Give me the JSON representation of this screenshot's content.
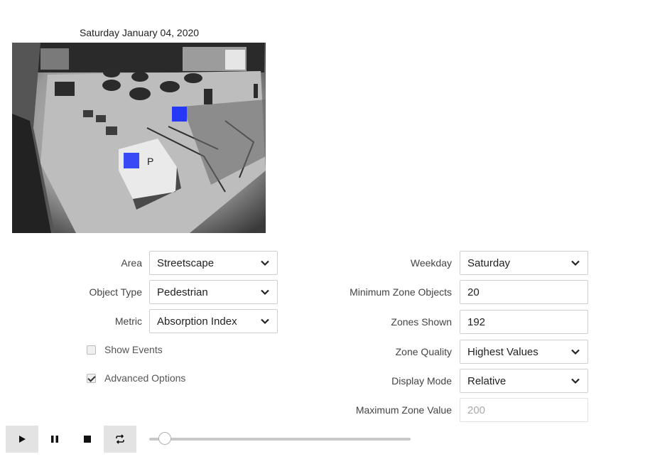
{
  "camera": {
    "date": "Saturday January 04, 2020",
    "sign_letter": "P"
  },
  "left_form": {
    "area": {
      "label": "Area",
      "value": "Streetscape"
    },
    "object_type": {
      "label": "Object Type",
      "value": "Pedestrian"
    },
    "metric": {
      "label": "Metric",
      "value": "Absorption Index"
    },
    "show_events": {
      "label": "Show Events",
      "checked": false
    },
    "advanced_options": {
      "label": "Advanced Options",
      "checked": true
    }
  },
  "right_form": {
    "weekday": {
      "label": "Weekday",
      "value": "Saturday"
    },
    "minimum_zone_objects": {
      "label": "Minimum Zone Objects",
      "value": "20"
    },
    "zones_shown": {
      "label": "Zones Shown",
      "value": "192"
    },
    "zone_quality": {
      "label": "Zone Quality",
      "value": "Highest Values"
    },
    "display_mode": {
      "label": "Display Mode",
      "value": "Relative"
    },
    "maximum_zone_value": {
      "label": "Maximum Zone Value",
      "value": "200"
    }
  },
  "player": {
    "buttons": [
      "play-icon",
      "pause-icon",
      "stop-icon",
      "loop-icon"
    ],
    "progress": 0.02
  },
  "colors": {
    "zone_marker": "#2438f5"
  }
}
